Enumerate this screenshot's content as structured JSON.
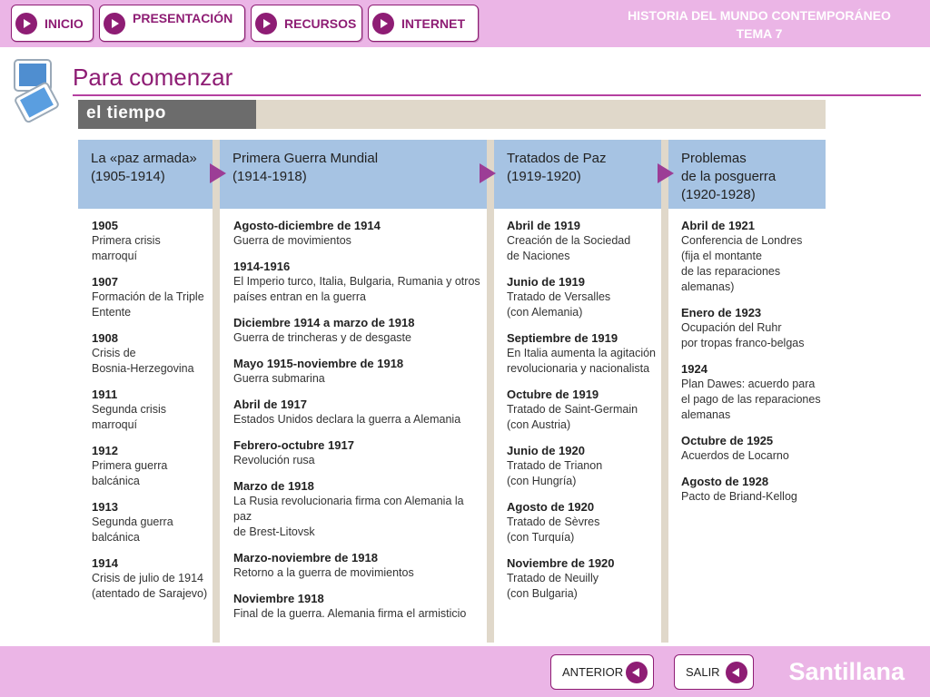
{
  "nav": {
    "inicio": "INICIO",
    "presentacion": "PRESENTACIÓN",
    "recursos": "RECURSOS",
    "internet": "INTERNET"
  },
  "header": {
    "subject": "HISTORIA DEL MUNDO CONTEMPORÁNEO",
    "unit": "TEMA 7"
  },
  "page": {
    "title": "Para comenzar"
  },
  "figure": {
    "tab": "el tiempo",
    "columns": [
      {
        "title": "La «paz armada»\n(1905-1914)",
        "events": [
          {
            "date": "1905",
            "text": "Primera crisis\nmarroquí"
          },
          {
            "date": "1907",
            "text": "Formación de la Triple\nEntente"
          },
          {
            "date": "1908",
            "text": "Crisis de\nBosnia-Herzegovina"
          },
          {
            "date": "1911",
            "text": "Segunda crisis\nmarroquí"
          },
          {
            "date": "1912",
            "text": "Primera guerra\nbalcánica"
          },
          {
            "date": "1913",
            "text": "Segunda guerra\nbalcánica"
          },
          {
            "date": "1914",
            "text": "Crisis de julio de 1914\n(atentado de Sarajevo)"
          }
        ]
      },
      {
        "title": "Primera Guerra Mundial\n(1914-1918)",
        "events": [
          {
            "date": "Agosto-diciembre de 1914",
            "text": "Guerra de movimientos"
          },
          {
            "date": "1914-1916",
            "text": "El Imperio turco, Italia, Bulgaria, Rumania y otros\npaíses entran en la guerra"
          },
          {
            "date": "Diciembre 1914 a marzo de 1918",
            "text": "Guerra de trincheras y de desgaste"
          },
          {
            "date": "Mayo 1915-noviembre de 1918",
            "text": "Guerra submarina"
          },
          {
            "date": "Abril de 1917",
            "text": "Estados Unidos declara la guerra a Alemania"
          },
          {
            "date": "Febrero-octubre 1917",
            "text": "Revolución rusa"
          },
          {
            "date": "Marzo de 1918",
            "text": "La Rusia revolucionaria firma con Alemania la paz\nde Brest-Litovsk"
          },
          {
            "date": "Marzo-noviembre de 1918",
            "text": "Retorno a la guerra de movimientos"
          },
          {
            "date": "Noviembre 1918",
            "text": "Final de la guerra. Alemania firma el armisticio"
          }
        ]
      },
      {
        "title": "Tratados de Paz\n(1919-1920)",
        "events": [
          {
            "date": "Abril de 1919",
            "text": "Creación de la Sociedad\nde Naciones"
          },
          {
            "date": "Junio de 1919",
            "text": "Tratado de Versalles\n(con Alemania)"
          },
          {
            "date": "Septiembre de 1919",
            "text": "En Italia aumenta la agitación\nrevolucionaria y nacionalista"
          },
          {
            "date": "Octubre de 1919",
            "text": "Tratado de Saint-Germain\n(con Austria)"
          },
          {
            "date": "Junio de 1920",
            "text": "Tratado de Trianon\n(con Hungría)"
          },
          {
            "date": "Agosto de 1920",
            "text": "Tratado de Sèvres\n(con Turquía)"
          },
          {
            "date": "Noviembre de 1920",
            "text": "Tratado de Neuilly\n(con Bulgaria)"
          }
        ]
      },
      {
        "title": "Problemas\nde la posguerra\n(1920-1928)",
        "events": [
          {
            "date": "Abril de 1921",
            "text": "Conferencia de Londres\n(fija el montante\nde las reparaciones\nalemanas)"
          },
          {
            "date": "Enero de 1923",
            "text": "Ocupación del Ruhr\npor tropas franco-belgas"
          },
          {
            "date": "1924",
            "text": "Plan Dawes: acuerdo para\nel pago de las reparaciones\nalemanas"
          },
          {
            "date": "Octubre de 1925",
            "text": "Acuerdos de Locarno"
          },
          {
            "date": "Agosto de 1928",
            "text": "Pacto de Briand-Kellog"
          }
        ]
      }
    ]
  },
  "footer": {
    "prev": "ANTERIOR",
    "exit": "SALIR",
    "brand": "Santillana"
  },
  "colors": {
    "accent": "#8e1d74",
    "bar": "#ebb5e6",
    "period_header": "#a6c3e3",
    "arrow": "#9c3d96"
  }
}
